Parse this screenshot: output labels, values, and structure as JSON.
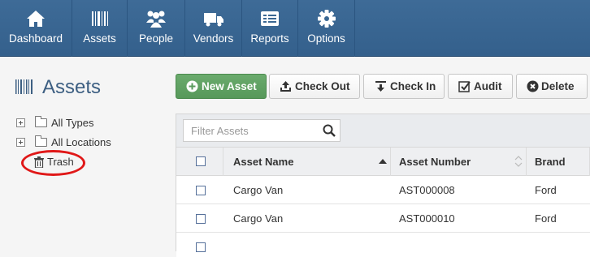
{
  "nav": {
    "items": [
      {
        "label": "Dashboard",
        "icon": "home-icon"
      },
      {
        "label": "Assets",
        "icon": "barcode-icon"
      },
      {
        "label": "People",
        "icon": "people-icon"
      },
      {
        "label": "Vendors",
        "icon": "truck-icon"
      },
      {
        "label": "Reports",
        "icon": "report-icon"
      },
      {
        "label": "Options",
        "icon": "gear-icon"
      }
    ]
  },
  "sidebar": {
    "title": "Assets",
    "tree": [
      {
        "label": "All Types"
      },
      {
        "label": "All Locations"
      },
      {
        "label": "Trash"
      }
    ]
  },
  "toolbar": {
    "new_asset": "New Asset",
    "check_out": "Check Out",
    "check_in": "Check In",
    "audit": "Audit",
    "delete": "Delete"
  },
  "filter": {
    "placeholder": "Filter Assets"
  },
  "table": {
    "columns": [
      "Asset Name",
      "Asset Number",
      "Brand"
    ],
    "rows": [
      {
        "name": "Cargo Van",
        "number": "AST000008",
        "brand": "Ford"
      },
      {
        "name": "Cargo Van",
        "number": "AST000010",
        "brand": "Ford"
      }
    ]
  },
  "colors": {
    "nav_bg": "#3a6792",
    "primary_green": "#5fa262",
    "highlight_circle": "#e01818",
    "title_blue": "#3d5f82"
  }
}
